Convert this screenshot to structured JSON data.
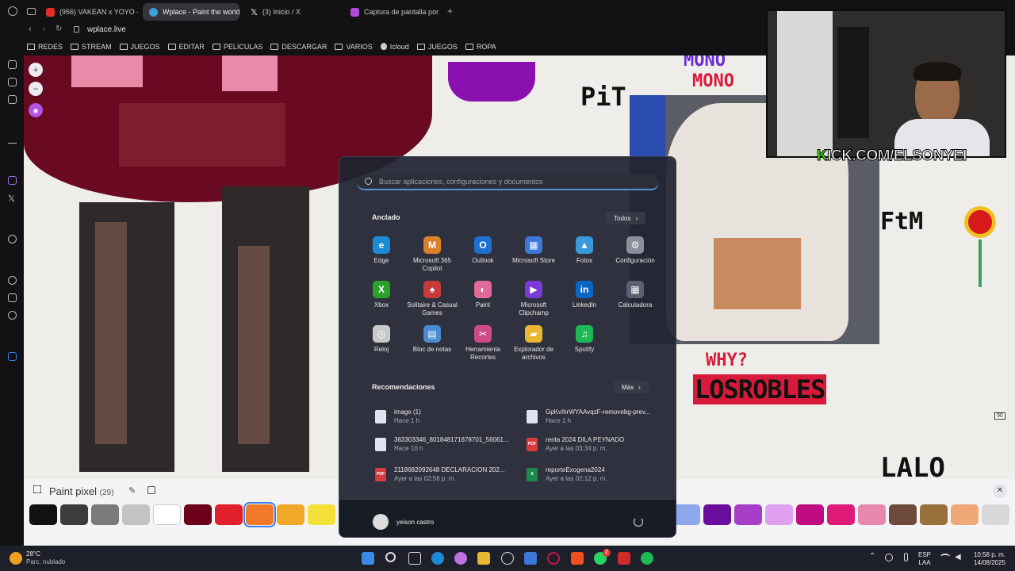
{
  "browser": {
    "tabs": [
      {
        "label": "(956) VAKEAN x YOYO - ",
        "color": "#e52d27"
      },
      {
        "label": "Wplace - Paint the world",
        "color": "#3aa0d8"
      },
      {
        "label": "(3) Inicio / X",
        "color": "#ffffff"
      },
      {
        "label": "Captura de pantalla por L",
        "color": "#b04ad8"
      }
    ],
    "url": "wplace.live",
    "bookmarks": [
      "REDES",
      "STREAM",
      "JUEGOS",
      "EDITAR",
      "PELICULAS",
      "DESCARGAR",
      "VARIOS",
      "Icloud",
      "JUEGOS",
      "ROPA"
    ]
  },
  "canvas": {
    "texts": [
      "PiT",
      "MONO",
      "MONO",
      "FtM",
      "WHY?",
      "LOSROBLES",
      "LALO"
    ],
    "scale_marker": "90"
  },
  "stream": {
    "kick_prefix": "K",
    "kick_rest": "ICK.COM/ELSONYEI"
  },
  "paint": {
    "title": "Paint pixel",
    "count": "(29)",
    "palette_left": [
      "#111111",
      "#3c3c3c",
      "#7a7a7a",
      "#c3c3c3",
      "#ffffff",
      "#6b0018",
      "#e0202a",
      "#f07a28",
      "#f0a828",
      "#f5e03a"
    ],
    "palette_right": [
      "#8ea8ee",
      "#6a0e9e",
      "#a83ec8",
      "#e0a0f0",
      "#c00c80",
      "#e01a78",
      "#e888ae",
      "#6e4a3a",
      "#98703a",
      "#f0a878",
      "#d8d8d8"
    ],
    "selected_index": 7
  },
  "start_menu": {
    "search_placeholder": "Buscar aplicaciones, configuraciones y documentos",
    "pinned_title": "Anclado",
    "all_button": "Todos",
    "apps": [
      {
        "name": "Edge",
        "color": "#1b8bd6"
      },
      {
        "name": "Microsoft 365 Copilot",
        "color": "#d9822b"
      },
      {
        "name": "Outlook",
        "color": "#1e6fd0"
      },
      {
        "name": "Microsoft Store",
        "color": "#3c78d8"
      },
      {
        "name": "Fotos",
        "color": "#3a9ad9"
      },
      {
        "name": "Configuración",
        "color": "#8a8f9c"
      },
      {
        "name": "Xbox",
        "color": "#2aa12a"
      },
      {
        "name": "Solitaire & Casual Games",
        "color": "#c83a3a"
      },
      {
        "name": "Paint",
        "color": "#e06a9a"
      },
      {
        "name": "Microsoft Clipchamp",
        "color": "#7a3ad8"
      },
      {
        "name": "LinkedIn",
        "color": "#0a66c2"
      },
      {
        "name": "Calculadora",
        "color": "#5a6070"
      },
      {
        "name": "Reloj",
        "color": "#c8c8c8"
      },
      {
        "name": "Bloc de notas",
        "color": "#4a8ad0"
      },
      {
        "name": "Herramienta Recortes",
        "color": "#d04a8a"
      },
      {
        "name": "Explorador de archivos",
        "color": "#e8b830"
      },
      {
        "name": "Spotify",
        "color": "#1db954"
      }
    ],
    "recs_title": "Recomendaciones",
    "more_button": "Más",
    "recommendations": [
      {
        "name": "image (1)",
        "time": "Hace 1 h",
        "type": "img"
      },
      {
        "name": "GpKvIhrWYAAvqzF-removebg-prev...",
        "time": "Hace 1 h",
        "type": "img"
      },
      {
        "name": "363303346_801848171678701_56061...",
        "time": "Hace 10 h",
        "type": "img"
      },
      {
        "name": "renta 2024 DILA PEYNADO",
        "time": "Ayer a las 03:34 p. m.",
        "type": "pdf"
      },
      {
        "name": "2118682092648 DECLARACION 202...",
        "time": "Ayer a las 02:56 p. m.",
        "type": "pdf"
      },
      {
        "name": "reporteExogena2024",
        "time": "Ayer a las 02:12 p. m.",
        "type": "xls"
      }
    ],
    "user": "yeison castro"
  },
  "taskbar": {
    "temp": "28°C",
    "weather": "Parc. nublado",
    "lang1": "ESP",
    "lang2": "LAA",
    "time": "10:58 p. m.",
    "date": "14/08/2025",
    "notif_badge": "2"
  }
}
